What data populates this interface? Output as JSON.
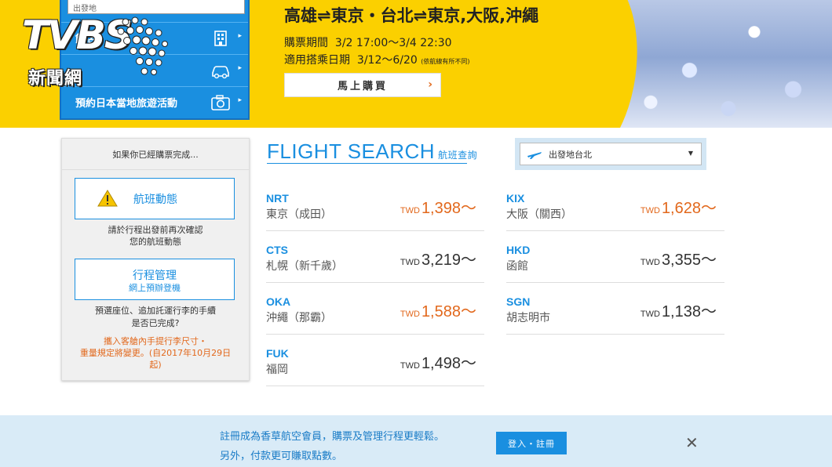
{
  "banner": {
    "title": "高雄⇌東京・台北⇌東京,大阪,沖繩",
    "sale_period_label": "購票期間",
    "sale_period": "3/2 17:00～3/4 22:30",
    "travel_period_label": "適用搭乘日期",
    "travel_period": "3/12～6/20",
    "travel_note": "(依航線有所不同)",
    "buy_button": "馬上購買",
    "buy_arrow": "›"
  },
  "side_menu": {
    "search_value": "出發地",
    "items": [
      {
        "label": "飯店",
        "icon": "hotel-icon"
      },
      {
        "label": "",
        "icon": "car-icon"
      },
      {
        "label": "預約日本當地旅遊活動",
        "icon": "camera-icon"
      }
    ],
    "arrow": "▸"
  },
  "logo": {
    "main": "TVBS",
    "sub": "新聞網"
  },
  "left_panel": {
    "header": "如果你已經購票完成...",
    "flight_status_label": "航班動態",
    "flight_status_note_1": "請於行程出發前再次確認",
    "flight_status_note_2": "您的航班動態",
    "manage_label": "行程管理",
    "manage_sub": "網上預辦登機",
    "manage_note_1": "預選座位、追加託運行李的手續",
    "manage_note_2": "是否已完成?",
    "notice_1": "攜入客艙內手提行李尺寸・",
    "notice_2": "重量規定將變更。(自2017年10月29日",
    "notice_3": "起)"
  },
  "flight_search": {
    "title": "FLIGHT SEARCH",
    "title_sub": "航班查詢",
    "origin": "出發地台北",
    "caret": "▼",
    "currency": "TWD",
    "routes_left": [
      {
        "code": "NRT",
        "city": "東京（成田）",
        "price": "1,398～",
        "highlight": true
      },
      {
        "code": "CTS",
        "city": "札幌（新千歲）",
        "price": "3,219～",
        "highlight": false
      },
      {
        "code": "OKA",
        "city": "沖繩（那霸）",
        "price": "1,588～",
        "highlight": true
      },
      {
        "code": "FUK",
        "city": "福岡",
        "price": "1,498～",
        "highlight": false
      }
    ],
    "routes_right": [
      {
        "code": "KIX",
        "city": "大阪（關西）",
        "price": "1,628～",
        "highlight": true
      },
      {
        "code": "HKD",
        "city": "函館",
        "price": "3,355～",
        "highlight": false
      },
      {
        "code": "SGN",
        "city": "胡志明市",
        "price": "1,138～",
        "highlight": false
      }
    ]
  },
  "bottom_bar": {
    "text_1": "註冊成為香草航空會員，購票及管理行程更輕鬆。",
    "text_2": "另外，付款更可賺取點數。",
    "login_button": "登入・註冊",
    "close": "✕"
  },
  "colors": {
    "brand_yellow": "#fbd000",
    "brand_blue": "#1a8fe0",
    "price_orange": "#e2681c"
  }
}
